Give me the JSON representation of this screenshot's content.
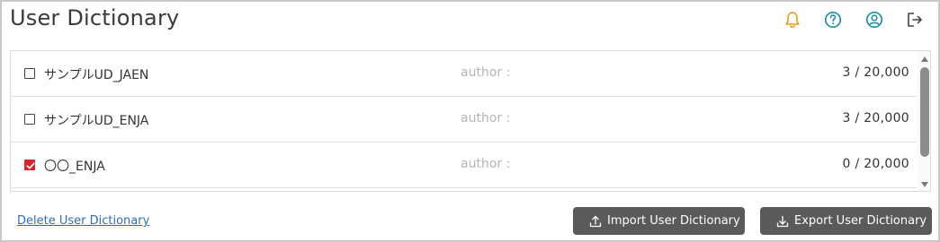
{
  "header": {
    "title": "User Dictionary",
    "icons": [
      "bell-icon",
      "help-icon",
      "user-account-icon",
      "logout-icon"
    ],
    "bell_color": "#e99a1c",
    "accent_color": "#1b8fa8"
  },
  "dictionaries": [
    {
      "name": "サンプルUD_JAEN",
      "author": "author :",
      "count": "3 / 20,000",
      "checked": false
    },
    {
      "name": "サンプルUD_ENJA",
      "author": "author :",
      "count": "3 / 20,000",
      "checked": false
    },
    {
      "name": "〇〇_ENJA",
      "author": "author :",
      "count": "0 / 20,000",
      "checked": true
    }
  ],
  "footer": {
    "delete_link": "Delete User Dictionary",
    "import_label": "Import User Dictionary",
    "export_label": "Export User Dictionary"
  },
  "colors": {
    "checkbox_checked": "#d9232e",
    "button_bg": "#5a5a5a",
    "link": "#2f6fb3"
  }
}
